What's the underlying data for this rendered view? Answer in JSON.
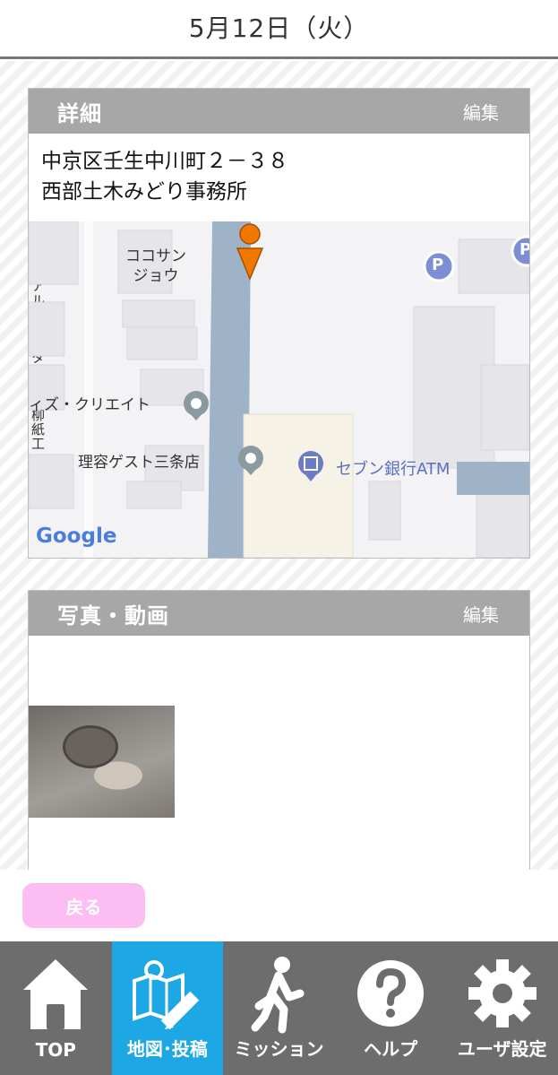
{
  "header": {
    "date": "5月12日（火）"
  },
  "details": {
    "title": "詳細",
    "edit_label": "編集",
    "address_line1": "中京区壬生中川町２－３８",
    "address_line2": "西部土木みどり事務所"
  },
  "map": {
    "labels": {
      "kokosan": "ココサン\nジョウ",
      "kokosan_1": "ココサン",
      "kokosan_2": "ジョウ",
      "kyoto_bijutsu_1": "京都",
      "kyoto_bijutsu_2": "美京",
      "izu_create": "ィズ・クリエイト",
      "riyou_guest": "理容ゲスト三条店",
      "seven_bank": "セブン銀行ATM",
      "altista": "アルティスタ三条",
      "oyanagi_1": "大柳",
      "oyanagi_2": "紙工",
      "parking": "P",
      "google": "Google"
    }
  },
  "photos": {
    "title": "写真・動画",
    "edit_label": "編集"
  },
  "back_button": {
    "label": "戻る"
  },
  "tabs": [
    {
      "label": "TOP",
      "icon": "home-icon",
      "active": false
    },
    {
      "label": "地図･投稿",
      "icon": "map-pencil-icon",
      "active": true
    },
    {
      "label": "ミッション",
      "icon": "walking-person-icon",
      "active": false
    },
    {
      "label": "ヘルプ",
      "icon": "help-icon",
      "active": false
    },
    {
      "label": "ユーザ設定",
      "icon": "gear-icon",
      "active": false
    }
  ],
  "colors": {
    "accent": "#1ea7e5",
    "tabbar": "#6d6d6d",
    "card_header": "#a7a7a7",
    "back_button": "#fbbdf2",
    "pin": "#f07800"
  }
}
